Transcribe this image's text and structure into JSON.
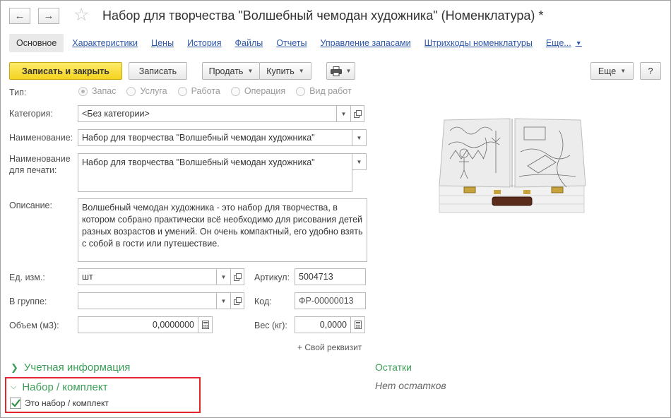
{
  "header": {
    "title": "Набор для творчества \"Волшебный чемодан художника\" (Номенклатура) *",
    "back_glyph": "←",
    "forward_glyph": "→",
    "star_glyph": "☆"
  },
  "tabs": [
    {
      "label": "Основное"
    },
    {
      "label": "Характеристики"
    },
    {
      "label": "Цены"
    },
    {
      "label": "История"
    },
    {
      "label": "Файлы"
    },
    {
      "label": "Отчеты"
    },
    {
      "label": "Управление запасами"
    },
    {
      "label": "Штрихкоды номенклатуры"
    },
    {
      "label": "Еще..."
    }
  ],
  "toolbar": {
    "save_close": "Записать и закрыть",
    "save": "Записать",
    "sell": "Продать",
    "buy": "Купить",
    "more": "Еще",
    "help": "?"
  },
  "form": {
    "type_label": "Тип:",
    "type_options": [
      "Запас",
      "Услуга",
      "Работа",
      "Операция",
      "Вид работ"
    ],
    "type_selected": "Запас",
    "category_label": "Категория:",
    "category_value": "<Без категории>",
    "name_label": "Наименование:",
    "name_value": "Набор для творчества \"Волшебный чемодан художника\"",
    "print_name_label_1": "Наименование",
    "print_name_label_2": "для печати:",
    "print_name_value": "Набор для творчества \"Волшебный чемодан художника\"",
    "description_label": "Описание:",
    "description_value": "Волшебный чемодан художника - это набор для творчества, в котором собрано практически всё необходимо для рисования детей разных возрастов и умений. Он очень компактный, его удобно взять с собой в гости или путешествие.",
    "unit_label": "Ед. изм.:",
    "unit_value": "шт",
    "article_label": "Артикул:",
    "article_value": "5004713",
    "group_label": "В группе:",
    "group_value": "",
    "code_label": "Код:",
    "code_value": "ФР-00000013",
    "volume_label": "Объем (м3):",
    "volume_value": "0,0000000",
    "weight_label": "Вес (кг):",
    "weight_value": "0,0000",
    "custom_attr": "+ Свой реквизит"
  },
  "sections": {
    "accounting": "Учетная информация",
    "kit": "Набор / комплект",
    "kit_checkbox": "Это набор / комплект",
    "kit_checked": true,
    "stock_title": "Остатки",
    "stock_empty": "Нет остатков"
  },
  "colors": {
    "accent_green": "#3b9e57",
    "link_blue": "#2e58a8",
    "primary_yellow": "#f5d320",
    "highlight_red": "#e3262b"
  }
}
